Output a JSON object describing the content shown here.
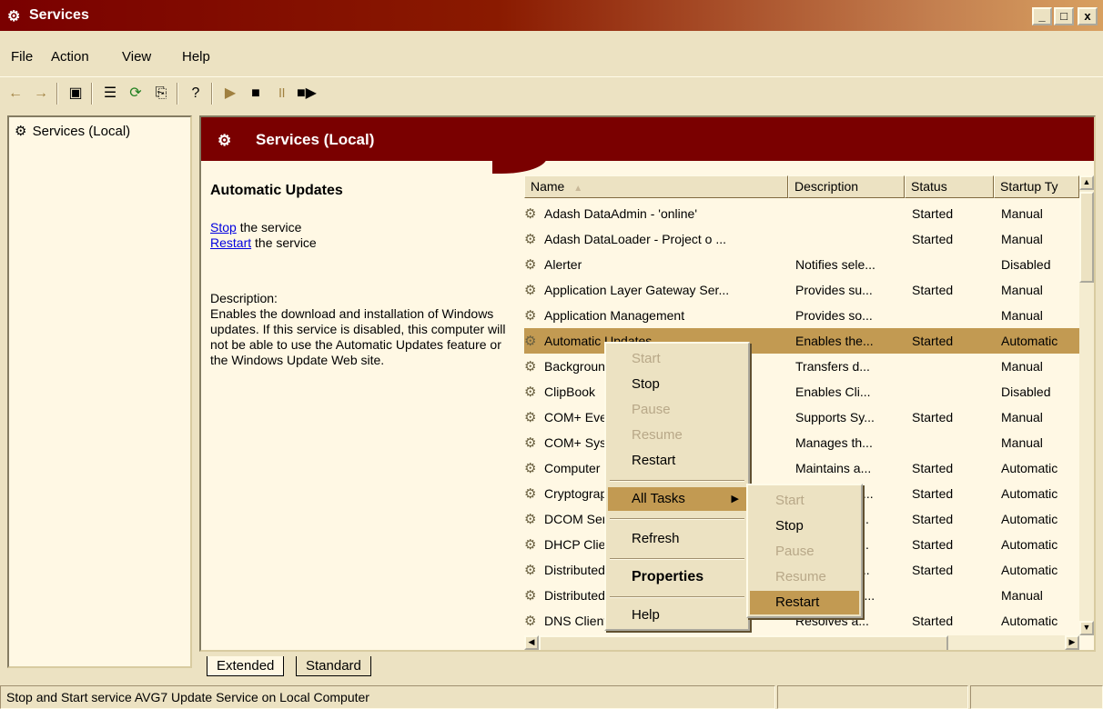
{
  "window": {
    "title": "Services",
    "minimize": "_",
    "maximize": "□",
    "close": "x"
  },
  "menubar": [
    "File",
    "Action",
    "View",
    "Help"
  ],
  "tree": {
    "root": "Services (Local)"
  },
  "banner": {
    "title": "Services (Local)"
  },
  "detail": {
    "service_name": "Automatic Updates",
    "stop_link": "Stop",
    "stop_suffix": " the service",
    "restart_link": "Restart",
    "restart_suffix": " the service",
    "desc_label": "Description:",
    "desc_text": "Enables the download and installation of Windows updates. If this service is disabled, this computer will not be able to use the Automatic Updates feature or the Windows Update Web site."
  },
  "columns": [
    "Name",
    "Description",
    "Status",
    "Startup Ty"
  ],
  "sort_indicator": "▲",
  "rows": [
    {
      "name": "Adash DataAdmin - 'online'",
      "desc": "",
      "status": "Started",
      "startup": "Manual"
    },
    {
      "name": "Adash DataLoader - Project o ...",
      "desc": "",
      "status": "Started",
      "startup": "Manual"
    },
    {
      "name": "Alerter",
      "desc": "Notifies sele...",
      "status": "",
      "startup": "Disabled"
    },
    {
      "name": "Application Layer Gateway Ser...",
      "desc": "Provides su...",
      "status": "Started",
      "startup": "Manual"
    },
    {
      "name": "Application Management",
      "desc": "Provides so...",
      "status": "",
      "startup": "Manual"
    },
    {
      "name": "Automatic Updates",
      "desc": "Enables the...",
      "status": "Started",
      "startup": "Automatic"
    },
    {
      "name": "Background Intelligent Transfe...",
      "desc": "Transfers d...",
      "status": "",
      "startup": "Manual"
    },
    {
      "name": "ClipBook",
      "desc": "Enables Cli...",
      "status": "",
      "startup": "Disabled"
    },
    {
      "name": "COM+ Event System",
      "desc": "Supports Sy...",
      "status": "Started",
      "startup": "Manual"
    },
    {
      "name": "COM+ System Application",
      "desc": "Manages th...",
      "status": "",
      "startup": "Manual"
    },
    {
      "name": "Computer Browser",
      "desc": "Maintains a...",
      "status": "Started",
      "startup": "Automatic"
    },
    {
      "name": "Cryptographic Services",
      "desc": "Provides thr...",
      "status": "Started",
      "startup": "Automatic"
    },
    {
      "name": "DCOM Server Process Launcher",
      "desc": "Provides la...",
      "status": "Started",
      "startup": "Automatic"
    },
    {
      "name": "DHCP Client",
      "desc": "Manages n...",
      "status": "Started",
      "startup": "Automatic"
    },
    {
      "name": "Distributed Link Tracking Client",
      "desc": "Maintains li...",
      "status": "Started",
      "startup": "Automatic"
    },
    {
      "name": "Distributed Transaction Coordi...",
      "desc": "Coordinates...",
      "status": "",
      "startup": "Manual"
    },
    {
      "name": "DNS Client",
      "desc": "Resolves a...",
      "status": "Started",
      "startup": "Automatic"
    }
  ],
  "context_menu": {
    "items": [
      "Start",
      "Stop",
      "Pause",
      "Resume",
      "Restart",
      "All Tasks",
      "Refresh",
      "Properties",
      "Help"
    ]
  },
  "submenu": {
    "items": [
      "Start",
      "Stop",
      "Pause",
      "Resume",
      "Restart"
    ]
  },
  "tabs": [
    "Extended",
    "Standard"
  ],
  "status": {
    "text": "Stop and Start service AVG7 Update Service on Local Computer"
  },
  "colors": {
    "title_dark": "#7a0000",
    "highlight": "#c29a52",
    "face": "#ece2c2"
  }
}
